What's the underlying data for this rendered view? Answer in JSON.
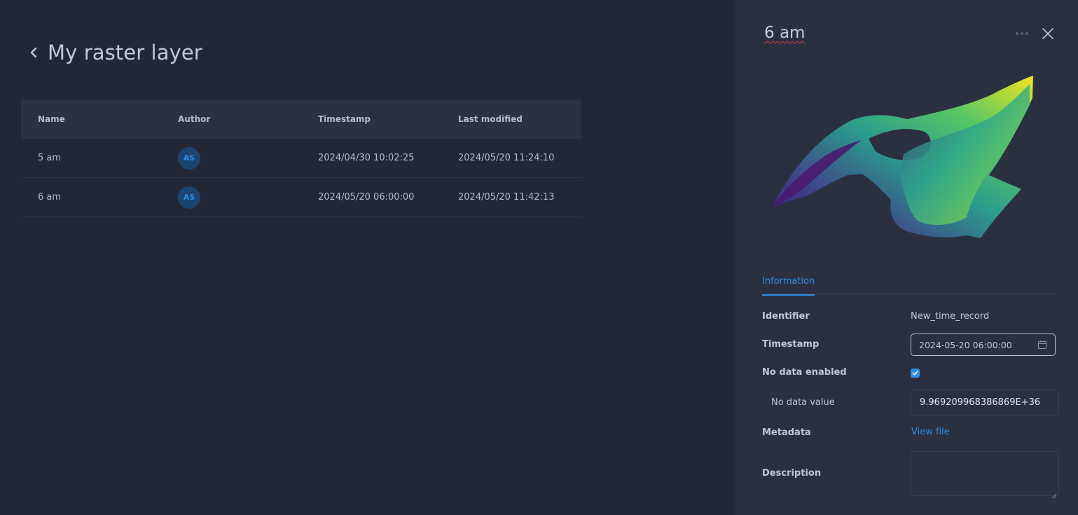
{
  "header": {
    "title": "My raster layer"
  },
  "table": {
    "columns": [
      "Name",
      "Author",
      "Timestamp",
      "Last modified"
    ],
    "rows": [
      {
        "name": "5 am",
        "author": "AS",
        "timestamp": "2024/04/30 10:02:25",
        "modified": "2024/05/20 11:24:10"
      },
      {
        "name": "6 am",
        "author": "AS",
        "timestamp": "2024/05/20 06:00:00",
        "modified": "2024/05/20 11:42:13"
      }
    ]
  },
  "panel": {
    "title": "6 am",
    "tab": "Information",
    "identifier": {
      "label": "Identifier",
      "value": "New_time_record"
    },
    "timestamp": {
      "label": "Timestamp",
      "value": "2024-05-20 06:00:00"
    },
    "nodata_enabled": {
      "label": "No data enabled",
      "checked": true
    },
    "nodata_value": {
      "label": "No data value",
      "value": "9.969209968386869E+36"
    },
    "metadata": {
      "label": "Metadata",
      "link": "View file"
    },
    "description": {
      "label": "Description",
      "value": ""
    }
  },
  "colors": {
    "background": "#222735",
    "panel": "#2b3040",
    "accent": "#2e8fe6",
    "avatar_bg": "#1c4470"
  }
}
